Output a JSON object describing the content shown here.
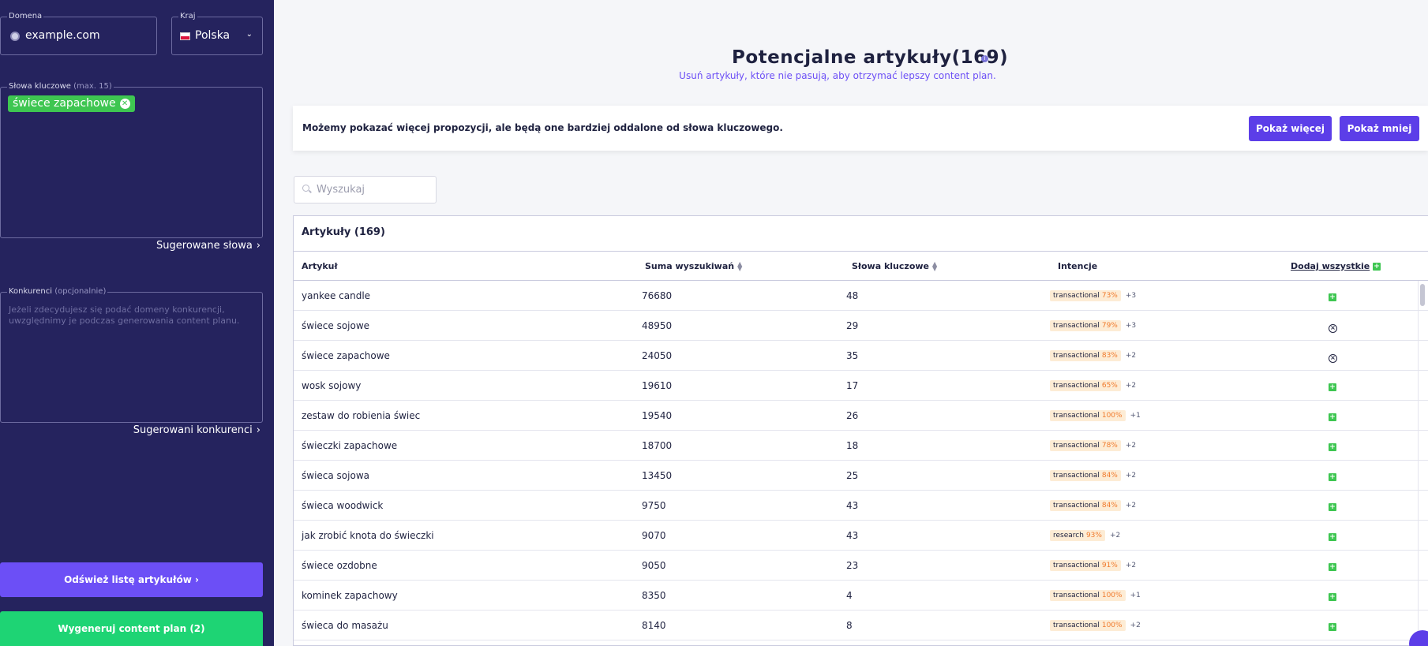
{
  "sidebar": {
    "domain_label": "Domena",
    "domain_value": "example.com",
    "country_label": "Kraj",
    "country_value": "Polska",
    "keywords_label": "Słowa kluczowe",
    "keywords_hint": "(max. 15)",
    "keyword_chip": "świece zapachowe",
    "suggested_words": "Sugerowane słowa",
    "competitors_label": "Konkurenci",
    "competitors_hint": "(opcjonalnie)",
    "competitors_placeholder": "Jeżeli zdecydujesz się podać domeny konkurencji, uwzględnimy je podczas generowania content planu.",
    "suggested_competitors": "Sugerowani konkurenci",
    "refresh_button": "Odśwież listę artykułów",
    "generate_button": "Wygeneruj content plan (2)"
  },
  "main": {
    "title": "Potencjalne artykuły(169)",
    "subtitle": "Usuń artykuły, które nie pasują, aby otrzymać lepszy content plan.",
    "notice_text": "Możemy pokazać więcej propozycji, ale będą one bardziej oddalone od słowa kluczowego.",
    "show_more": "Pokaż więcej",
    "show_less": "Pokaż mniej",
    "search_placeholder": "Wyszukaj",
    "table_title": "Artykuły (169)",
    "columns": {
      "article": "Artykuł",
      "sum": "Suma wyszukiwań",
      "keywords": "Słowa kluczowe",
      "intents": "Intencje",
      "add_all": "Dodaj wszystkie"
    },
    "rows": [
      {
        "article": "yankee candle",
        "sum": "76680",
        "keywords": "48",
        "intent": "transactional",
        "pct": "73%",
        "more": "+3",
        "action": "add"
      },
      {
        "article": "świece sojowe",
        "sum": "48950",
        "keywords": "29",
        "intent": "transactional",
        "pct": "79%",
        "more": "+3",
        "action": "remove"
      },
      {
        "article": "świece zapachowe",
        "sum": "24050",
        "keywords": "35",
        "intent": "transactional",
        "pct": "83%",
        "more": "+2",
        "action": "remove"
      },
      {
        "article": "wosk sojowy",
        "sum": "19610",
        "keywords": "17",
        "intent": "transactional",
        "pct": "65%",
        "more": "+2",
        "action": "add"
      },
      {
        "article": "zestaw do robienia świec",
        "sum": "19540",
        "keywords": "26",
        "intent": "transactional",
        "pct": "100%",
        "more": "+1",
        "action": "add"
      },
      {
        "article": "świeczki zapachowe",
        "sum": "18700",
        "keywords": "18",
        "intent": "transactional",
        "pct": "78%",
        "more": "+2",
        "action": "add"
      },
      {
        "article": "świeca sojowa",
        "sum": "13450",
        "keywords": "25",
        "intent": "transactional",
        "pct": "84%",
        "more": "+2",
        "action": "add"
      },
      {
        "article": "świeca woodwick",
        "sum": "9750",
        "keywords": "43",
        "intent": "transactional",
        "pct": "84%",
        "more": "+2",
        "action": "add"
      },
      {
        "article": "jak zrobić knota do świeczki",
        "sum": "9070",
        "keywords": "43",
        "intent": "research",
        "pct": "93%",
        "more": "+2",
        "action": "add"
      },
      {
        "article": "świece ozdobne",
        "sum": "9050",
        "keywords": "23",
        "intent": "transactional",
        "pct": "91%",
        "more": "+2",
        "action": "add"
      },
      {
        "article": "kominek zapachowy",
        "sum": "8350",
        "keywords": "4",
        "intent": "transactional",
        "pct": "100%",
        "more": "+1",
        "action": "add"
      },
      {
        "article": "świeca do masażu",
        "sum": "8140",
        "keywords": "8",
        "intent": "transactional",
        "pct": "100%",
        "more": "+2",
        "action": "add"
      }
    ]
  },
  "colors": {
    "sidebar_bg": "#25235e",
    "accent_purple": "#5c3ee8",
    "accent_green": "#1ed474",
    "chip_green": "#3ec651"
  }
}
